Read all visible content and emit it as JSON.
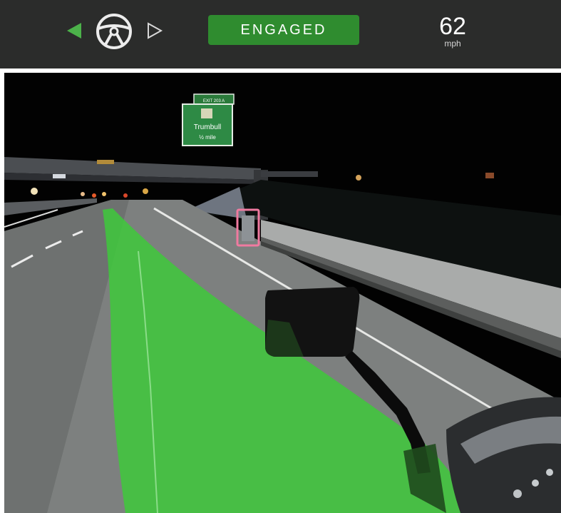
{
  "hud": {
    "status_label": "ENGAGED",
    "speed_value": "62",
    "speed_unit": "mph",
    "icons": {
      "left": "chevron-left-icon",
      "wheel": "steering-wheel-icon",
      "right": "chevron-right-icon"
    },
    "colors": {
      "bar_background": "#2b2c2b",
      "engaged_green": "#2f8c2f",
      "signal_green": "#4cb24a",
      "planned_path_green": "#3ec93b",
      "detection_box": "#f07aa0"
    }
  },
  "camera": {
    "sign": {
      "tab_text": "EXIT 203 A",
      "name": "Trumbull",
      "distance": "½ mile"
    }
  }
}
